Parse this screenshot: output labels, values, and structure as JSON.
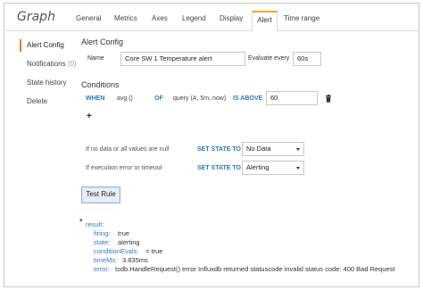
{
  "header": {
    "title": "Graph",
    "tabs": [
      "General",
      "Metrics",
      "Axes",
      "Legend",
      "Display",
      "Alert",
      "Time range"
    ],
    "active_tab": "Alert"
  },
  "sidebar": {
    "items": [
      {
        "label": "Alert Config"
      },
      {
        "label": "Notifications",
        "count": "(0)"
      },
      {
        "label": "State history"
      },
      {
        "label": "Delete"
      }
    ]
  },
  "alert_config": {
    "heading": "Alert Config",
    "name_label": "Name",
    "name_value": "Core SW 1 Temperature alert",
    "evaluate_label": "Evaluate every",
    "evaluate_value": "60s"
  },
  "conditions": {
    "heading": "Conditions",
    "when": "WHEN",
    "reducer": "avg ()",
    "of": "OF",
    "query": "query (A, 5m, now)",
    "evaluator": "IS ABOVE",
    "threshold": "60",
    "add_symbol": "+"
  },
  "no_data": {
    "label": "If no data or all values are null",
    "set_state": "SET STATE TO",
    "value": "No Data"
  },
  "exec_error": {
    "label": "If execution error or timeout",
    "set_state": "SET STATE TO",
    "value": "Alerting"
  },
  "test_rule": {
    "button_label": "Test Rule"
  },
  "result": {
    "toggle": "▾",
    "root_key": "result:",
    "rows": [
      {
        "key": "firing:",
        "value": "true"
      },
      {
        "key": "state:",
        "value": "alerting"
      },
      {
        "key": "conditionEvals:",
        "value": "= true"
      },
      {
        "key": "timeMs:",
        "value": "3.835ms"
      },
      {
        "key": "error:",
        "value": "tsdb.HandleRequest() error Influxdb returned statuscode invalid status code: 400 Bad Request"
      }
    ]
  },
  "colors": {
    "accent_orange": "#eb7b18",
    "keyword_blue": "#2a7ab8"
  }
}
